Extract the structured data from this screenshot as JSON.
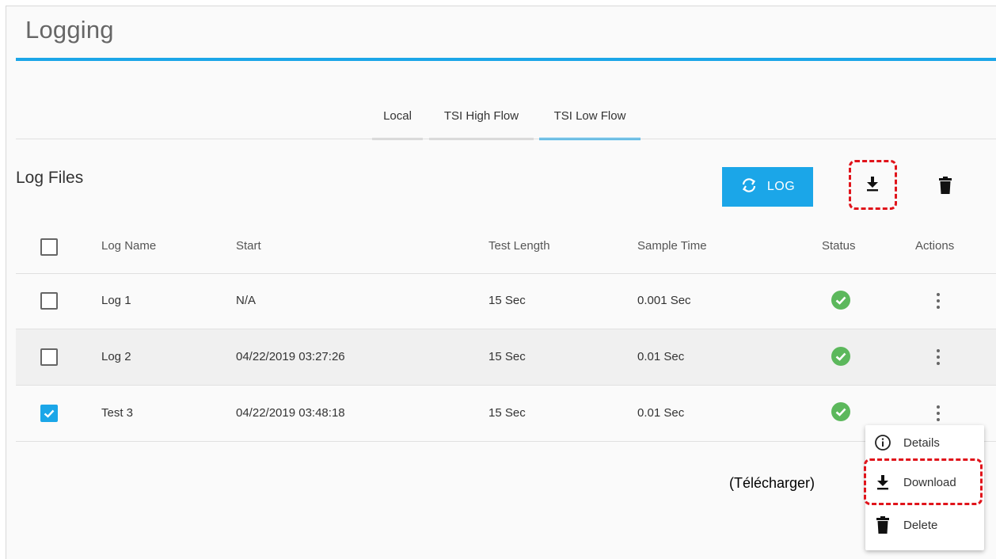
{
  "page": {
    "title": "Logging"
  },
  "tabs": [
    {
      "label": "Local",
      "active": false
    },
    {
      "label": "TSI High Flow",
      "active": false
    },
    {
      "label": "TSI Low Flow",
      "active": true
    }
  ],
  "section": {
    "title": "Log Files"
  },
  "toolbar": {
    "log_button_label": "LOG",
    "download_icon": "download-icon",
    "delete_icon": "trash-icon"
  },
  "table": {
    "headers": [
      "Log Name",
      "Start",
      "Test Length",
      "Sample Time",
      "Status",
      "Actions"
    ],
    "rows": [
      {
        "checked": false,
        "name": "Log 1",
        "start": "N/A",
        "test_length": "15 Sec",
        "sample_time": "0.001 Sec",
        "status": "ok"
      },
      {
        "checked": false,
        "name": "Log 2",
        "start": "04/22/2019 03:27:26",
        "test_length": "15 Sec",
        "sample_time": "0.01 Sec",
        "status": "ok"
      },
      {
        "checked": true,
        "name": "Test 3",
        "start": "04/22/2019 03:48:18",
        "test_length": "15 Sec",
        "sample_time": "0.01 Sec",
        "status": "ok"
      }
    ]
  },
  "context_menu": {
    "items": [
      {
        "label": "Details",
        "icon": "info-icon"
      },
      {
        "label": "Download",
        "icon": "download-icon"
      },
      {
        "label": "Delete",
        "icon": "trash-icon"
      }
    ]
  },
  "annotation": {
    "text": "(Télécharger)"
  },
  "colors": {
    "accent": "#1ba6e8",
    "success": "#5cb85c",
    "highlight": "#e0141b"
  }
}
